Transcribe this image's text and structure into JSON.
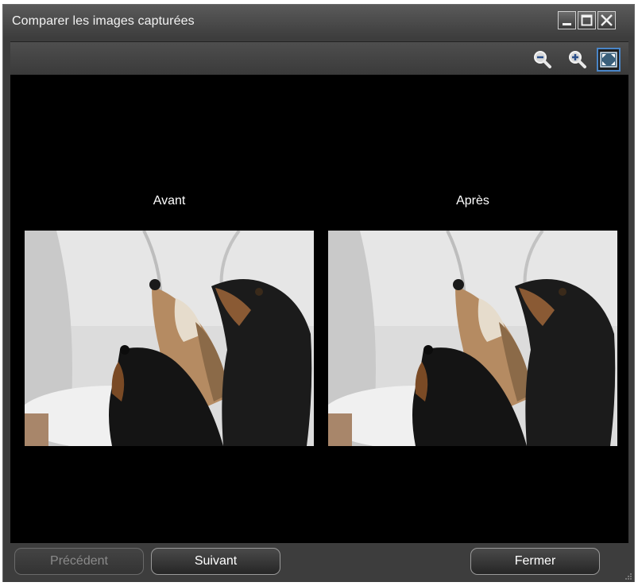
{
  "window": {
    "title": "Comparer les images capturées"
  },
  "toolbar": {
    "zoom_out_icon": "zoom-out-icon",
    "zoom_in_icon": "zoom-in-icon",
    "fit_icon": "fit-to-window-icon"
  },
  "comparison": {
    "before_label": "Avant",
    "after_label": "Après"
  },
  "footer": {
    "previous_label": "Précédent",
    "next_label": "Suivant",
    "close_label": "Fermer"
  },
  "colors": {
    "window_bg": "#3d3d3d",
    "canvas_bg": "#000000",
    "active_tool_border": "#4a86c8"
  }
}
